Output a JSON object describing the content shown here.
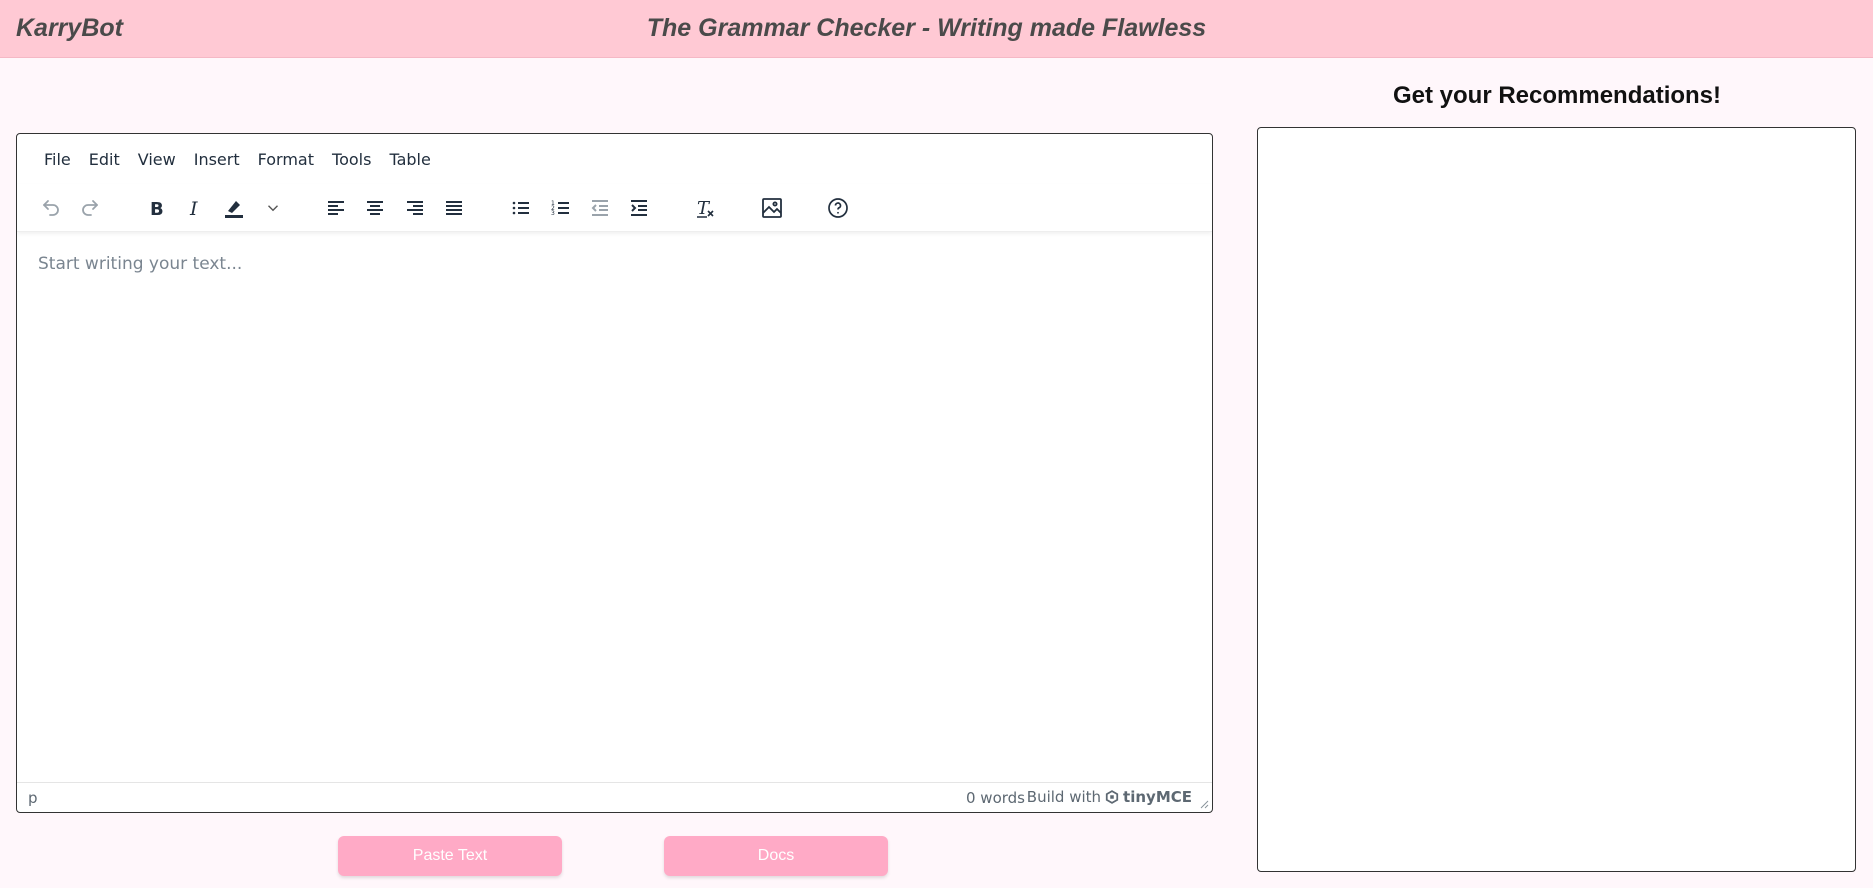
{
  "header": {
    "brand": "KarryBot",
    "title": "The Grammar Checker - Writing made Flawless"
  },
  "editor": {
    "menu": [
      "File",
      "Edit",
      "View",
      "Insert",
      "Format",
      "Tools",
      "Table"
    ],
    "toolbar_icons": [
      "undo-icon",
      "redo-icon",
      "bold-icon",
      "italic-icon",
      "highlight-icon",
      "chevron-down-icon",
      "align-left-icon",
      "align-center-icon",
      "align-right-icon",
      "align-justify-icon",
      "bullet-list-icon",
      "numbered-list-icon",
      "outdent-icon",
      "indent-icon",
      "clear-format-icon",
      "image-icon",
      "help-icon"
    ],
    "placeholder": "Start writing your text...",
    "status": {
      "path": "p",
      "word_count": "0 words",
      "build_with": "Build with",
      "brand": "tinyMCE"
    }
  },
  "actions": {
    "paste_label": "Paste Text",
    "docs_label": "Docs"
  },
  "recommendations": {
    "title": "Get your Recommendations!"
  },
  "colors": {
    "header_bg": "#ffc9d4",
    "page_bg": "#fff7fb",
    "button_bg": "#ffaac6"
  }
}
